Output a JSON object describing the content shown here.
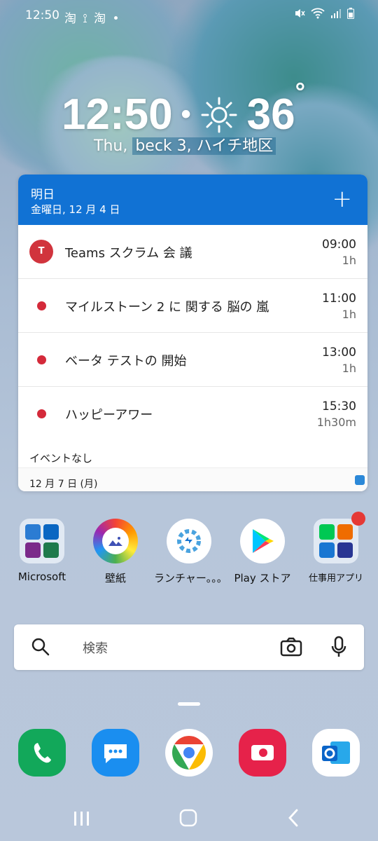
{
  "statusbar": {
    "time": "12:50",
    "notifications": "淘 ⟟ 淘 •",
    "icons": [
      "mute-icon",
      "wifi-icon",
      "signal-icon",
      "battery-icon"
    ]
  },
  "lockwidget": {
    "time": "12:50",
    "separator": "•",
    "temperature": "36",
    "degree": "°",
    "date_prefix": "Thu,",
    "date_highlight": "beck 3, ハイチ地区"
  },
  "calendar": {
    "header_title": "明日",
    "header_date": "金曜日, 12 月 4 日",
    "add_icon": "plus-icon",
    "events": [
      {
        "title": "Teams スクラム 会 議",
        "time": "09:00",
        "duration": "1h",
        "icon": "teams-icon"
      },
      {
        "title": "マイルストーン 2 に 関する 脳の 嵐",
        "time": "11:00",
        "duration": "1h"
      },
      {
        "title": "ベータ テストの 開始",
        "time": "13:00",
        "duration": "1h"
      },
      {
        "title": "ハッピーアワー",
        "time": "15:30",
        "duration": "1h30m"
      }
    ],
    "no_events": "イベントなし",
    "next_day": "12 月 7 日 (月)"
  },
  "apps": [
    {
      "label": "Microsoft",
      "type": "folder"
    },
    {
      "label": "壁紙",
      "type": "gallery"
    },
    {
      "label": "ランチャー。。。",
      "type": "launcher"
    },
    {
      "label": "Play ストア",
      "type": "play"
    },
    {
      "label": "仕事用アプリ",
      "type": "folder-work"
    }
  ],
  "search": {
    "placeholder": "検索"
  },
  "colors": {
    "accent": "#1172d4",
    "event_dot": "#d42a3a"
  }
}
